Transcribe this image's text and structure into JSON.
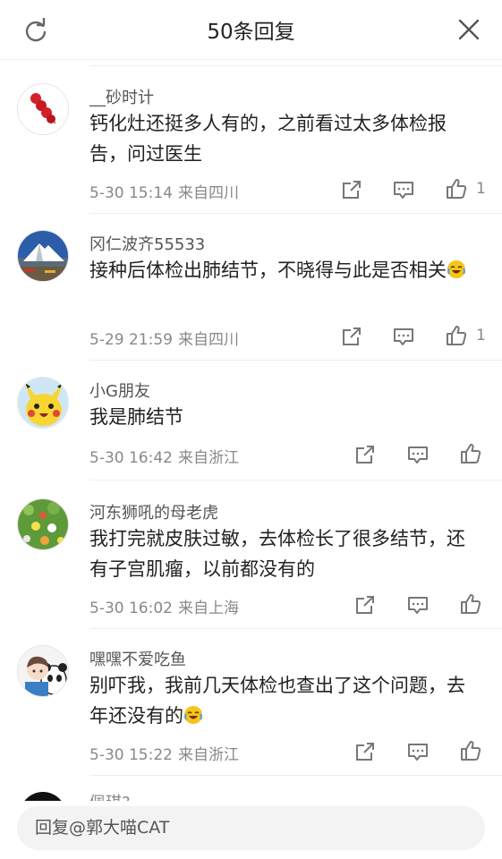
{
  "header": {
    "title": "50条回复"
  },
  "comments": [
    {
      "username": "__砂时计",
      "text": "钙化灶还挺多人有的，之前看过太多体检报告，问过医生",
      "time": "5-30 15:14",
      "location": "来自四川",
      "likes": "1",
      "avatar": "candied-haws-avatar"
    },
    {
      "username": "冈仁波齐55533",
      "text": "接种后体检出肺结节，不晓得与此是否相关",
      "time": "5-29 21:59",
      "location": "来自四川",
      "likes": "1",
      "avatar": "mountain-avatar",
      "emoji": "laughing-crying-emoji"
    },
    {
      "username": "小G朋友",
      "text": "我是肺结节",
      "time": "5-30 16:42",
      "location": "来自浙江",
      "likes": "",
      "avatar": "pikachu-avatar"
    },
    {
      "username": "河东狮吼的母老虎",
      "text": "我打完就皮肤过敏，去体检长了很多结节，还有子宫肌瘤，以前都没有的",
      "time": "5-30 16:02",
      "location": "来自上海",
      "likes": "",
      "avatar": "flower-avatar"
    },
    {
      "username": "嘿嘿不爱吃鱼",
      "text": "别吓我，我前几天体检也查出了这个问题，去年还没有的",
      "time": "5-30 15:22",
      "location": "来自浙江",
      "likes": "",
      "avatar": "anime-panda-avatar",
      "emoji": "laughing-crying-emoji"
    }
  ],
  "partial": {
    "username": "佩琪?"
  },
  "reply": {
    "placeholder": "回复@郭大喵CAT"
  },
  "colors": {
    "text": "#222222",
    "meta": "#888888",
    "separator": "#eeeeee",
    "input_bg": "#f3f3f3"
  }
}
